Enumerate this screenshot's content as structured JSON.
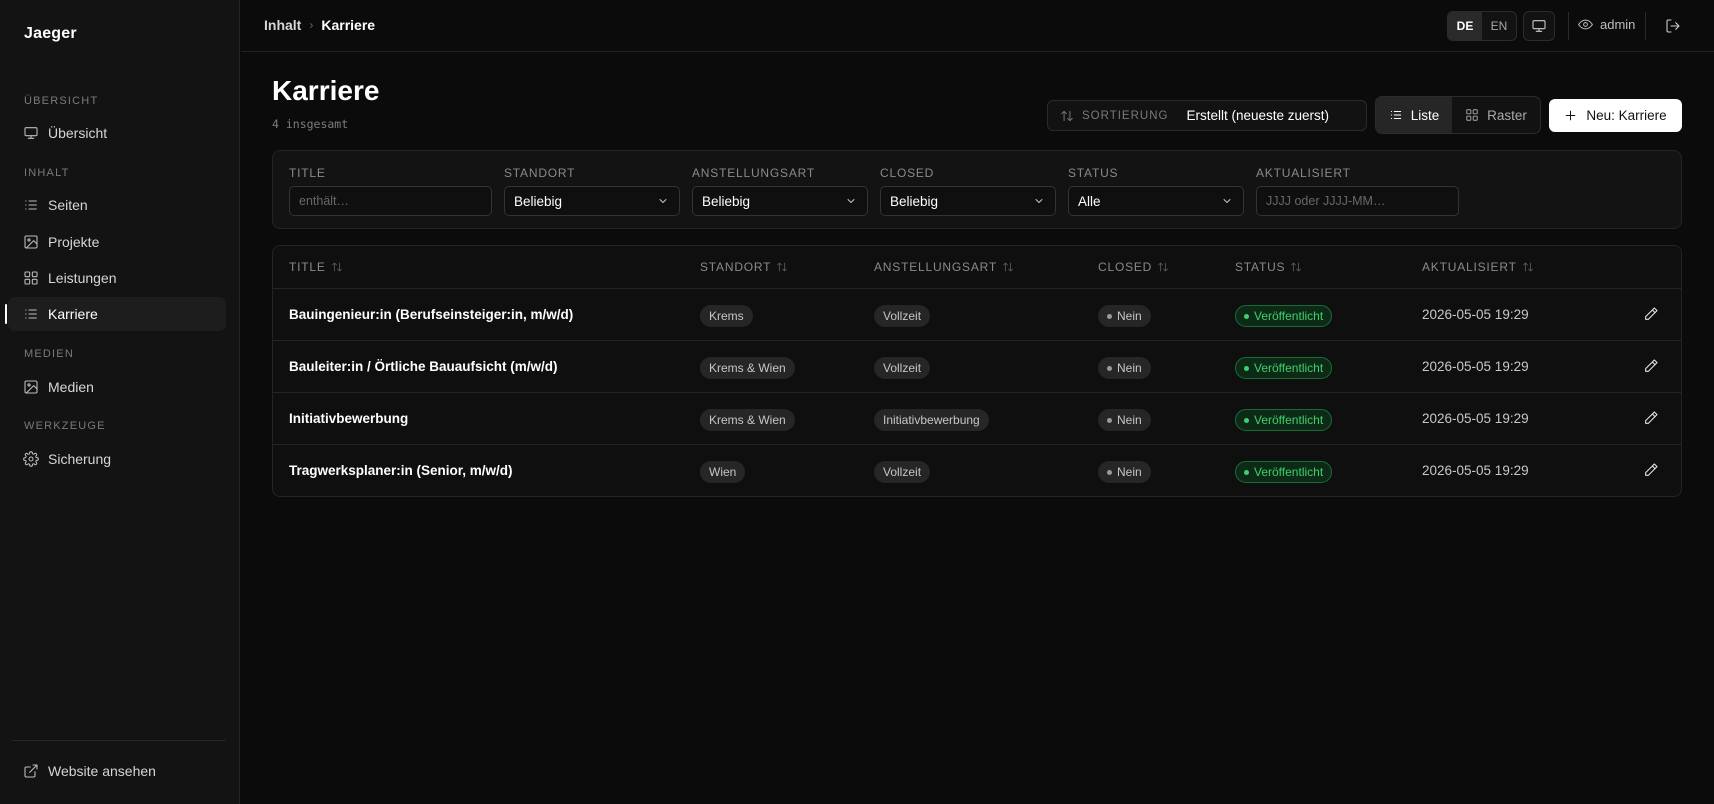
{
  "sidebar": {
    "brand": "Jaeger",
    "sections": [
      {
        "label": "ÜBERSICHT"
      },
      {
        "label": "INHALT"
      },
      {
        "label": "MEDIEN"
      },
      {
        "label": "WERKZEUGE"
      }
    ],
    "items": [
      {
        "label": "Übersicht",
        "icon": "monitor-icon"
      },
      {
        "label": "Seiten",
        "icon": "list-icon"
      },
      {
        "label": "Projekte",
        "icon": "image-icon"
      },
      {
        "label": "Leistungen",
        "icon": "grid-icon"
      },
      {
        "label": "Karriere",
        "icon": "list-icon",
        "active": true
      },
      {
        "label": "Medien",
        "icon": "image-icon"
      },
      {
        "label": "Sicherung",
        "icon": "gear-icon"
      }
    ],
    "footer_link": "Website ansehen"
  },
  "topbar": {
    "breadcrumb": [
      "Inhalt",
      "Karriere"
    ],
    "languages": [
      "DE",
      "EN"
    ],
    "active_language": "DE",
    "user": "admin"
  },
  "page": {
    "title": "Karriere",
    "count": "4 insgesamt"
  },
  "toolbar": {
    "sort_label": "SORTIERUNG",
    "sort_value": "Erstellt (neueste zuerst)",
    "view_list": "Liste",
    "view_grid": "Raster",
    "new_button": "Neu: Karriere"
  },
  "filters": {
    "title": {
      "label": "TITLE",
      "placeholder": "enthält…"
    },
    "standort": {
      "label": "STANDORT",
      "value": "Beliebig"
    },
    "anstellungsart": {
      "label": "ANSTELLUNGSART",
      "value": "Beliebig"
    },
    "closed": {
      "label": "CLOSED",
      "value": "Beliebig"
    },
    "status": {
      "label": "STATUS",
      "value": "Alle"
    },
    "aktualisiert": {
      "label": "AKTUALISIERT",
      "placeholder": "JJJJ oder JJJJ-MM…"
    }
  },
  "table": {
    "columns": [
      "TITLE",
      "STANDORT",
      "ANSTELLUNGSART",
      "CLOSED",
      "STATUS",
      "AKTUALISIERT"
    ],
    "rows": [
      {
        "title": "Bauingenieur:in (Berufseinsteiger:in, m/w/d)",
        "standort": "Krems",
        "anstellungsart": "Vollzeit",
        "closed": "Nein",
        "status": "Veröffentlicht",
        "updated": "2026-05-05 19:29"
      },
      {
        "title": "Bauleiter:in / Örtliche Bauaufsicht (m/w/d)",
        "standort": "Krems & Wien",
        "anstellungsart": "Vollzeit",
        "closed": "Nein",
        "status": "Veröffentlicht",
        "updated": "2026-05-05 19:29"
      },
      {
        "title": "Initiativbewerbung",
        "standort": "Krems & Wien",
        "anstellungsart": "Initiativbewerbung",
        "closed": "Nein",
        "status": "Veröffentlicht",
        "updated": "2026-05-05 19:29"
      },
      {
        "title": "Tragwerksplaner:in (Senior, m/w/d)",
        "standort": "Wien",
        "anstellungsart": "Vollzeit",
        "closed": "Nein",
        "status": "Veröffentlicht",
        "updated": "2026-05-05 19:29"
      }
    ]
  },
  "colors": {
    "background": "#0b0b0b",
    "sidebar": "#131313",
    "status_green": "#3fd06b",
    "primary_button": "#ffffff"
  }
}
